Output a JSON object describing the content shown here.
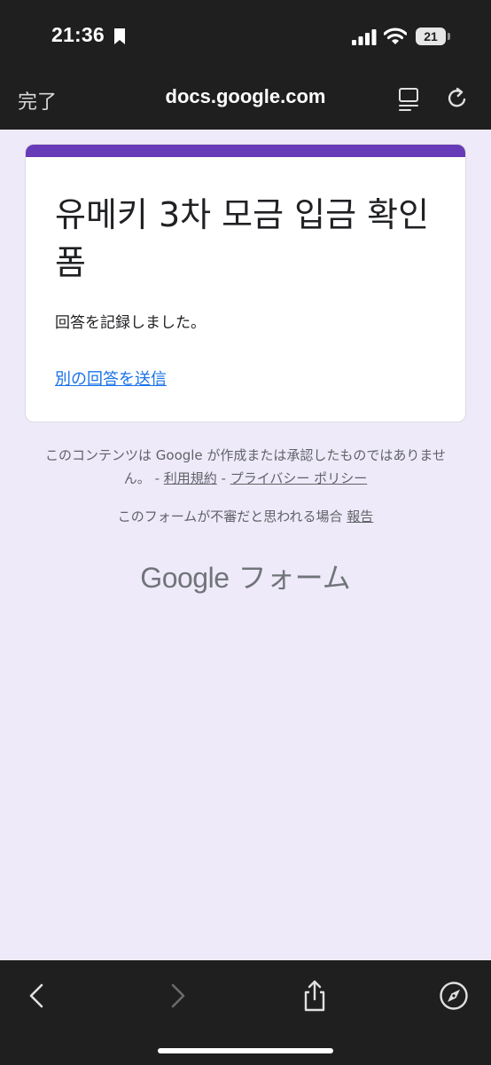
{
  "status_bar": {
    "time": "21:36",
    "battery_level": "21"
  },
  "browser": {
    "done_label": "完了",
    "url": "docs.google.com"
  },
  "form": {
    "title": "유메키 3차 모금 입금 확인 폼",
    "confirmation": "回答を記録しました。",
    "resubmit_link": "別の回答を送信",
    "accent_color": "#673ab7"
  },
  "footer": {
    "disclaimer_text": "このコンテンツは Google が作成または承認したものではありません。 - ",
    "terms_link": "利用規約",
    "separator": " - ",
    "privacy_link": "プライバシー ポリシー",
    "report_prefix": "このフォームが不審だと思われる場合 ",
    "report_link": "報告",
    "brand_google": "Google",
    "brand_forms": " フォーム"
  },
  "icons": {
    "bookmark": "bookmark-icon",
    "signal": "cellular-signal-icon",
    "wifi": "wifi-icon",
    "reader": "reader-view-icon",
    "reload": "reload-icon",
    "back": "chevron-left-icon",
    "forward": "chevron-right-icon",
    "share": "share-icon",
    "compass": "compass-icon"
  }
}
